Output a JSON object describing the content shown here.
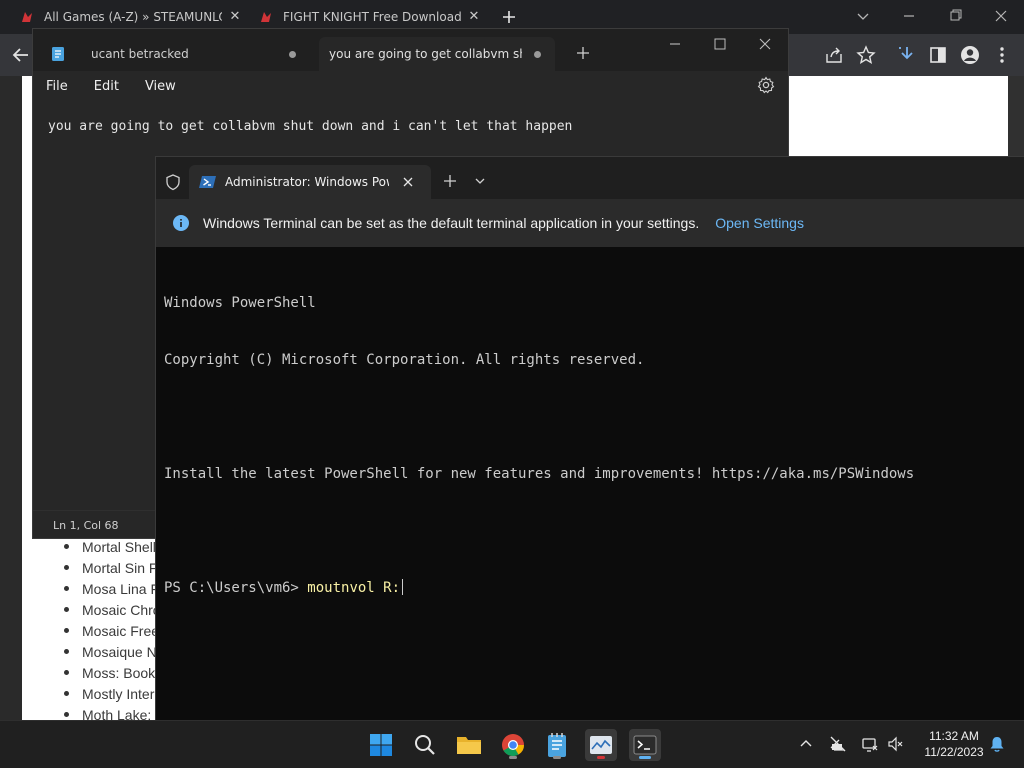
{
  "browser": {
    "tabs": [
      {
        "title": "All Games (A-Z) » STEAMUNLOCKED"
      },
      {
        "title": "FIGHT KNIGHT Free Download (v"
      }
    ],
    "page_list": [
      "Mortal Shell",
      "Mortal Sin F",
      "Mosa Lina F",
      "Mosaic Chro",
      "Mosaic Free",
      "Mosaique N",
      "Moss: Book",
      "Mostly Inter",
      "Moth Lake:"
    ]
  },
  "notepad": {
    "tabs": [
      {
        "title": "ucant betracked"
      },
      {
        "title": "you are going to get collabvm shut down"
      }
    ],
    "menu": [
      "File",
      "Edit",
      "View"
    ],
    "content": "you are going to get collabvm shut down and i can't let that happen",
    "status": "Ln 1, Col 68"
  },
  "terminal": {
    "tab_title": "Administrator: Windows PowerShell",
    "infobar": {
      "message": "Windows Terminal can be set as the default terminal application in your settings.",
      "link": "Open Settings"
    },
    "lines": [
      "Windows PowerShell",
      "Copyright (C) Microsoft Corporation. All rights reserved.",
      "",
      "Install the latest PowerShell for new features and improvements! https://aka.ms/PSWindows",
      ""
    ],
    "prompt": "PS C:\\Users\\vm6> ",
    "command": "moutnvol R:"
  },
  "taskbar": {
    "time": "11:32 AM",
    "date": "11/22/2023"
  },
  "colors": {
    "chrome_tab_red": "#d13438",
    "link_blue": "#6cb8f6",
    "windows_blue": "#0078d4",
    "ps_yellow": "#f9f1a5"
  }
}
